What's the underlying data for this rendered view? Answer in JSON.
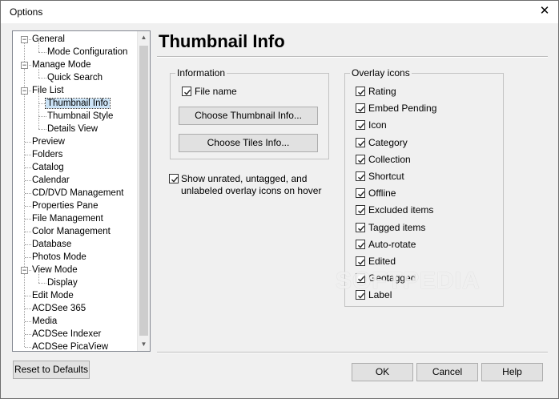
{
  "window": {
    "title": "Options"
  },
  "tree": {
    "items": [
      {
        "label": "General",
        "level": 0,
        "expander": "minus"
      },
      {
        "label": "Mode Configuration",
        "level": 1
      },
      {
        "label": "Manage Mode",
        "level": 0,
        "expander": "minus"
      },
      {
        "label": "Quick Search",
        "level": 1
      },
      {
        "label": "File List",
        "level": 0,
        "expander": "minus"
      },
      {
        "label": "Thumbnail Info",
        "level": 1,
        "selected": true
      },
      {
        "label": "Thumbnail Style",
        "level": 1
      },
      {
        "label": "Details View",
        "level": 1
      },
      {
        "label": "Preview",
        "level": 0
      },
      {
        "label": "Folders",
        "level": 0
      },
      {
        "label": "Catalog",
        "level": 0
      },
      {
        "label": "Calendar",
        "level": 0
      },
      {
        "label": "CD/DVD Management",
        "level": 0
      },
      {
        "label": "Properties Pane",
        "level": 0
      },
      {
        "label": "File Management",
        "level": 0
      },
      {
        "label": "Color Management",
        "level": 0
      },
      {
        "label": "Database",
        "level": 0
      },
      {
        "label": "Photos Mode",
        "level": 0
      },
      {
        "label": "View Mode",
        "level": 0,
        "expander": "minus"
      },
      {
        "label": "Display",
        "level": 1
      },
      {
        "label": "Edit Mode",
        "level": 0
      },
      {
        "label": "ACDSee 365",
        "level": 0
      },
      {
        "label": "Media",
        "level": 0
      },
      {
        "label": "ACDSee Indexer",
        "level": 0
      },
      {
        "label": "ACDSee PicaView",
        "level": 0
      }
    ]
  },
  "page": {
    "heading": "Thumbnail Info"
  },
  "information": {
    "title": "Information",
    "file_name": {
      "label": "File name",
      "checked": true
    },
    "choose_thumbnail_info": "Choose Thumbnail Info...",
    "choose_tiles_info": "Choose Tiles Info..."
  },
  "show_unrated": {
    "label": "Show unrated, untagged, and unlabeled overlay icons on hover",
    "checked": true
  },
  "overlay": {
    "title": "Overlay icons",
    "items": [
      {
        "label": "Rating",
        "checked": true
      },
      {
        "label": "Embed Pending",
        "checked": true
      },
      {
        "label": "Icon",
        "checked": true
      },
      {
        "label": "Category",
        "checked": true
      },
      {
        "label": "Collection",
        "checked": true
      },
      {
        "label": "Shortcut",
        "checked": true
      },
      {
        "label": "Offline",
        "checked": true
      },
      {
        "label": "Excluded items",
        "checked": true
      },
      {
        "label": "Tagged items",
        "checked": true
      },
      {
        "label": "Auto-rotate",
        "checked": true
      },
      {
        "label": "Edited",
        "checked": true
      },
      {
        "label": "Geotagged",
        "checked": true
      },
      {
        "label": "Label",
        "checked": true
      }
    ]
  },
  "buttons": {
    "reset": "Reset to Defaults",
    "ok": "OK",
    "cancel": "Cancel",
    "help": "Help"
  },
  "watermark": "SOFTPEDIA"
}
